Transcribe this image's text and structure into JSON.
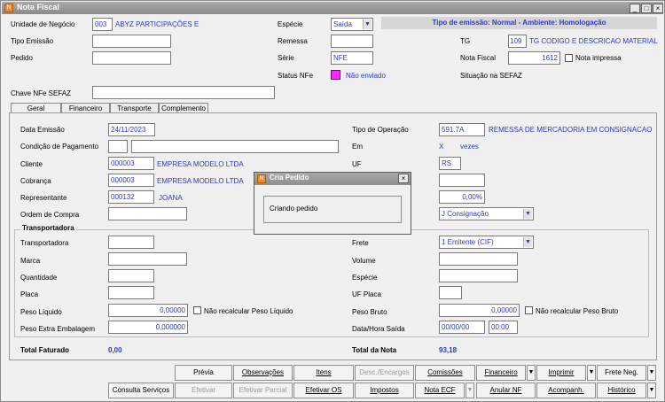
{
  "window": {
    "title": "Nota Fiscal"
  },
  "header": {
    "unidade_label": "Unidade de Negócio",
    "unidade_code": "003",
    "unidade_name": "ABYZ PARTICIPAÇÕES E",
    "especie_label": "Espécie",
    "especie_value": "Saída",
    "tipo_emissao_banner": "Tipo de emissão: Normal - Ambiente: Homologação",
    "tipo_emissao_label": "Tipo Emissão",
    "remessa_label": "Remessa",
    "tg_label": "TG",
    "tg_code": "109",
    "tg_name": "TG CODIGO E DESCRICAO MATERIAL",
    "pedido_label": "Pedido",
    "serie_label": "Série",
    "serie_value": "NFE",
    "nota_fiscal_label": "Nota Fiscal",
    "nota_fiscal_value": "1612",
    "nota_impressa_label": "Nota impressa",
    "status_label": "Status NFe",
    "status_value": "Não enviado",
    "status_color": "#ff28ff",
    "situacao_label": "Situação na SEFAZ",
    "chave_label": "Chave NFe SEFAZ"
  },
  "tabs": [
    "Geral",
    "Financeiro",
    "Transporte",
    "Complemento"
  ],
  "geral": {
    "data_emissao_label": "Data Emissão",
    "data_emissao_value": "24/11/2023",
    "tipo_operacao_label": "Tipo de Operação",
    "tipo_operacao_code": "591.7A",
    "tipo_operacao_desc": "REMESSA DE MERCADORIA EM CONSIGNACAO",
    "condicao_label": "Condição de Pagamento",
    "em_label": "Em",
    "em_x": "X",
    "vezes": "vezes",
    "cliente_label": "Cliente",
    "cliente_code": "000003",
    "cliente_name": "EMPRESA MODELO LTDA",
    "uf_label": "UF",
    "uf_value": "RS",
    "cobranca_label": "Cobrança",
    "cobranca_code": "000003",
    "cobranca_name": "EMPRESA MODELO LTDA",
    "representante_label": "Representante",
    "representante_code": "000132",
    "representante_name": "JOANA",
    "percent_value": "0,00%",
    "ordem_label": "Ordem de Compra",
    "consignacao_value": "J Consignação"
  },
  "transporte": {
    "group_title": "Transportadora",
    "transportadora_label": "Transportadora",
    "frete_label": "Frete",
    "frete_value": "1 Emitente (CIF)",
    "marca_label": "Marca",
    "volume_label": "Volume",
    "quantidade_label": "Quantidade",
    "especie_label": "Espécie",
    "placa_label": "Placa",
    "uf_placa_label": "UF Placa",
    "peso_liquido_label": "Peso Líquido",
    "peso_liquido_value": "0,00000",
    "nao_recalc_liq": "Não recalcular Peso Líquido",
    "peso_bruto_label": "Peso Bruto",
    "peso_bruto_value": "0,00000",
    "nao_recalc_bruto": "Não recalcular Peso Bruto",
    "peso_extra_label": "Peso Extra Embalagem",
    "peso_extra_value": "0,000000",
    "data_hora_label": "Data/Hora Saída",
    "data_value": "00/00/00",
    "hora_value": "00:00"
  },
  "totals": {
    "faturado_label": "Total Faturado",
    "faturado_value": "0,00",
    "nota_label": "Total da Nota",
    "nota_value": "93,18"
  },
  "buttons": {
    "previa": "Prévia",
    "observacoes": "Observações",
    "itens": "Itens",
    "desc_encargos": "Desc./Encargos",
    "comissoes": "Comissões",
    "financeiro": "Financeiro",
    "imprimir": "Imprimir",
    "frete_neg": "Frete Neg.",
    "consulta_servicos": "Consulta Serviços",
    "efetivar": "Efetivar",
    "efetivar_parcial": "Efetivar Parcial",
    "efetivar_os": "Efetivar OS",
    "impostos": "Impostos",
    "nota_ecf": "Nota ECF",
    "anular_nf": "Anular NF",
    "acompanh": "Acompanh.",
    "historico": "Histórico"
  },
  "dialog": {
    "title": "Cria Pedido",
    "message": "Criando pedido"
  }
}
